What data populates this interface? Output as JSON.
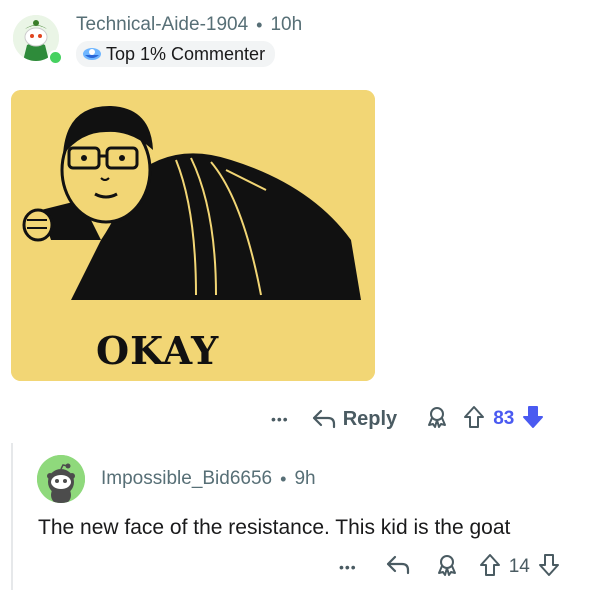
{
  "comment1": {
    "username": "Technical-Aide-1904",
    "separator": "•",
    "time": "10h",
    "flair": "Top 1% Commenter",
    "meme_text": "OKAY",
    "actions": {
      "more": "•••",
      "reply": "Reply",
      "votes": "83",
      "upvoted": true
    },
    "colors": {
      "upvote_active": "#4a5af1",
      "meme_bg": "#f2d675",
      "online": "#46d160"
    }
  },
  "comment2": {
    "username": "Impossible_Bid6656",
    "separator": "•",
    "time": "9h",
    "body": "The new face of the resistance. This kid is the goat",
    "actions": {
      "more": "•••",
      "votes": "14"
    }
  }
}
